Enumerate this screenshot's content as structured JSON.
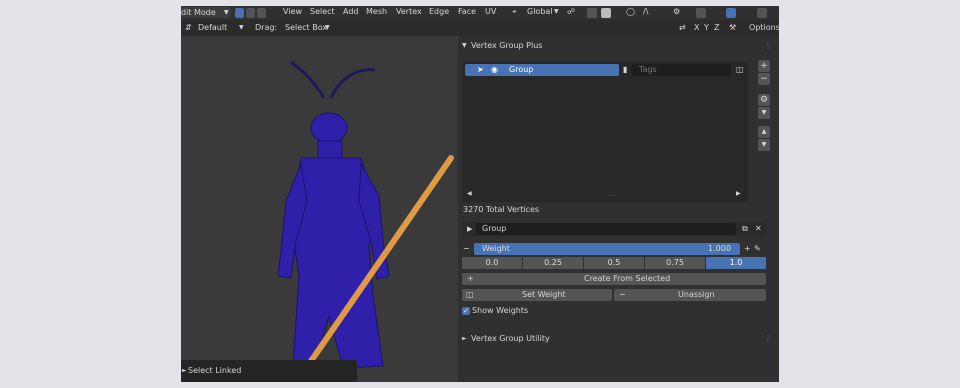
{
  "header": {
    "mode": "dit Mode",
    "menus": [
      "View",
      "Select",
      "Add",
      "Mesh",
      "Vertex",
      "Edge",
      "Face",
      "UV"
    ],
    "transform": "Global",
    "orientation": "Default",
    "drag_label": "Drag:",
    "drag_value": "Select Box",
    "axes": [
      "X",
      "Y",
      "Z"
    ],
    "options": "Options"
  },
  "panel": {
    "title": "Vertex Group Plus",
    "list_item": "Group",
    "tags_placeholder": "Tags",
    "total_vertices": "3270 Total Vertices",
    "group_name": "Group",
    "weight_label": "Weight",
    "weight_value": "1.000",
    "presets": [
      "0.0",
      "0.25",
      "0.5",
      "0.75",
      "1.0"
    ],
    "create_from_selected": "Create From Selected",
    "set_weight": "Set Weight",
    "unassign": "Unassign",
    "show_weights": "Show Weights",
    "utility_title": "Vertex Group Utility"
  },
  "viewport": {
    "last_operator": "Select Linked"
  },
  "colors": {
    "accent": "#4772b3",
    "mesh": "#2e20a8",
    "staff": "#e09a45"
  }
}
